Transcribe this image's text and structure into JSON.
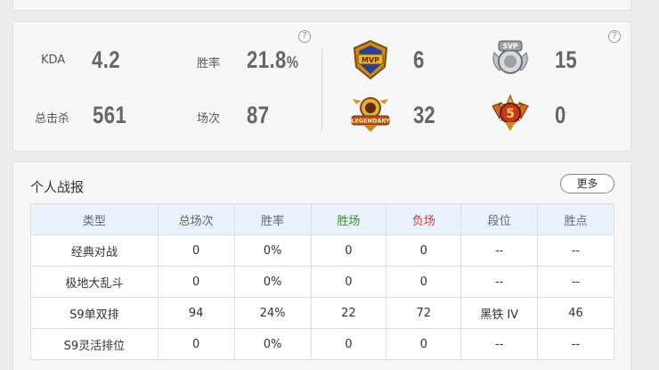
{
  "stats": {
    "kda": {
      "label": "KDA",
      "value": "4.2"
    },
    "win_rate": {
      "label": "胜率",
      "value": "21.8",
      "unit": "%"
    },
    "total_kills": {
      "label": "总击杀",
      "value": "561"
    },
    "matches": {
      "label": "场次",
      "value": "87"
    },
    "help_icon": "?"
  },
  "badges": [
    {
      "name": "mvp-badge-icon",
      "text": "MVP",
      "count": "6"
    },
    {
      "name": "svp-badge-icon",
      "text": "SVP",
      "count": "15"
    },
    {
      "name": "legendary-badge-icon",
      "text": "LEGENDARY",
      "count": "32"
    },
    {
      "name": "penta-kill-badge-icon",
      "text": "5",
      "count": "0"
    }
  ],
  "report": {
    "title": "个人战报",
    "more_label": "更多",
    "headers": [
      "类型",
      "总场次",
      "胜率",
      "胜场",
      "负场",
      "段位",
      "胜点"
    ],
    "rows": [
      [
        "经典对战",
        "0",
        "0%",
        "0",
        "0",
        "--",
        "--"
      ],
      [
        "极地大乱斗",
        "0",
        "0%",
        "0",
        "0",
        "--",
        "--"
      ],
      [
        "S9单双排",
        "94",
        "24%",
        "22",
        "72",
        "黑铁 IV",
        "46"
      ],
      [
        "S9灵活排位",
        "0",
        "0%",
        "0",
        "0",
        "--",
        "--"
      ]
    ]
  },
  "colors": {
    "win_header": "#3b8f3b",
    "loss_header": "#d33c3c",
    "table_header_bg": "#eaf2fb"
  }
}
